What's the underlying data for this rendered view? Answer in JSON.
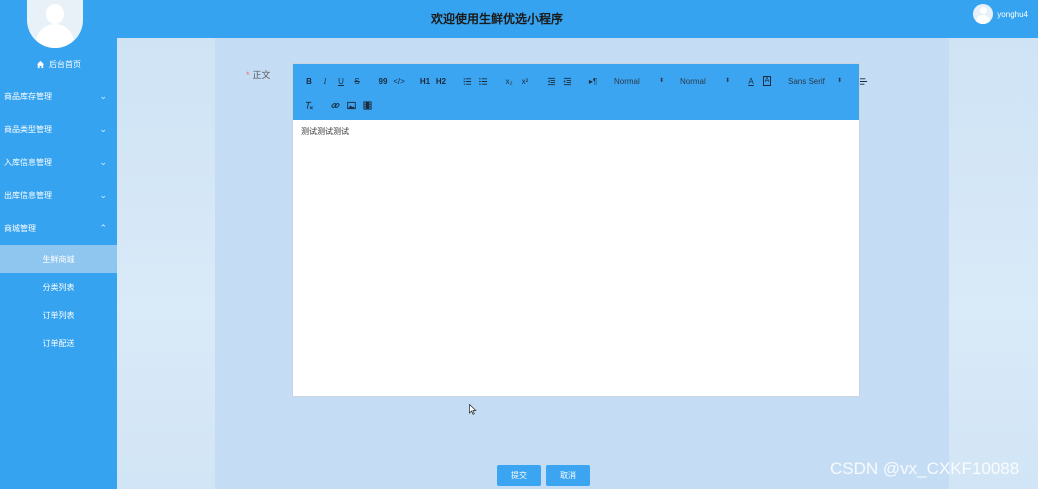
{
  "app": {
    "title": "欢迎使用生鲜优选小程序",
    "username": "yonghu4"
  },
  "sidebar": {
    "home_label": "后台首页",
    "menu": [
      {
        "label": "商品库存管理",
        "expanded": false
      },
      {
        "label": "商品类型管理",
        "expanded": false
      },
      {
        "label": "入库信息管理",
        "expanded": false
      },
      {
        "label": "出库信息管理",
        "expanded": false
      },
      {
        "label": "商城管理",
        "expanded": true
      }
    ],
    "submenu": [
      {
        "label": "生鲜商城",
        "active": true
      },
      {
        "label": "分类列表",
        "active": false
      },
      {
        "label": "订单列表",
        "active": false
      },
      {
        "label": "订单配送",
        "active": false
      }
    ]
  },
  "form": {
    "required_mark": "*",
    "body_label": "正文",
    "editor_content": "测试测试测试",
    "submit_label": "提交",
    "cancel_label": "取消"
  },
  "toolbar": {
    "bold": "B",
    "italic": "I",
    "underline": "U",
    "strike": "S",
    "blockquote": "99",
    "code": "</>",
    "h1": "H1",
    "h2": "H2",
    "subscript": "x₂",
    "superscript": "x²",
    "direction": "▸¶",
    "size_value": "Normal",
    "header_value": "Normal",
    "font_value": "Sans Serif",
    "color": "A",
    "background": "A"
  },
  "watermark": "CSDN @vx_CXKF10088",
  "colors": {
    "primary": "#35a3f0",
    "submenu_active": "#8fc6ef",
    "page_bg": "#d4e6f6"
  }
}
